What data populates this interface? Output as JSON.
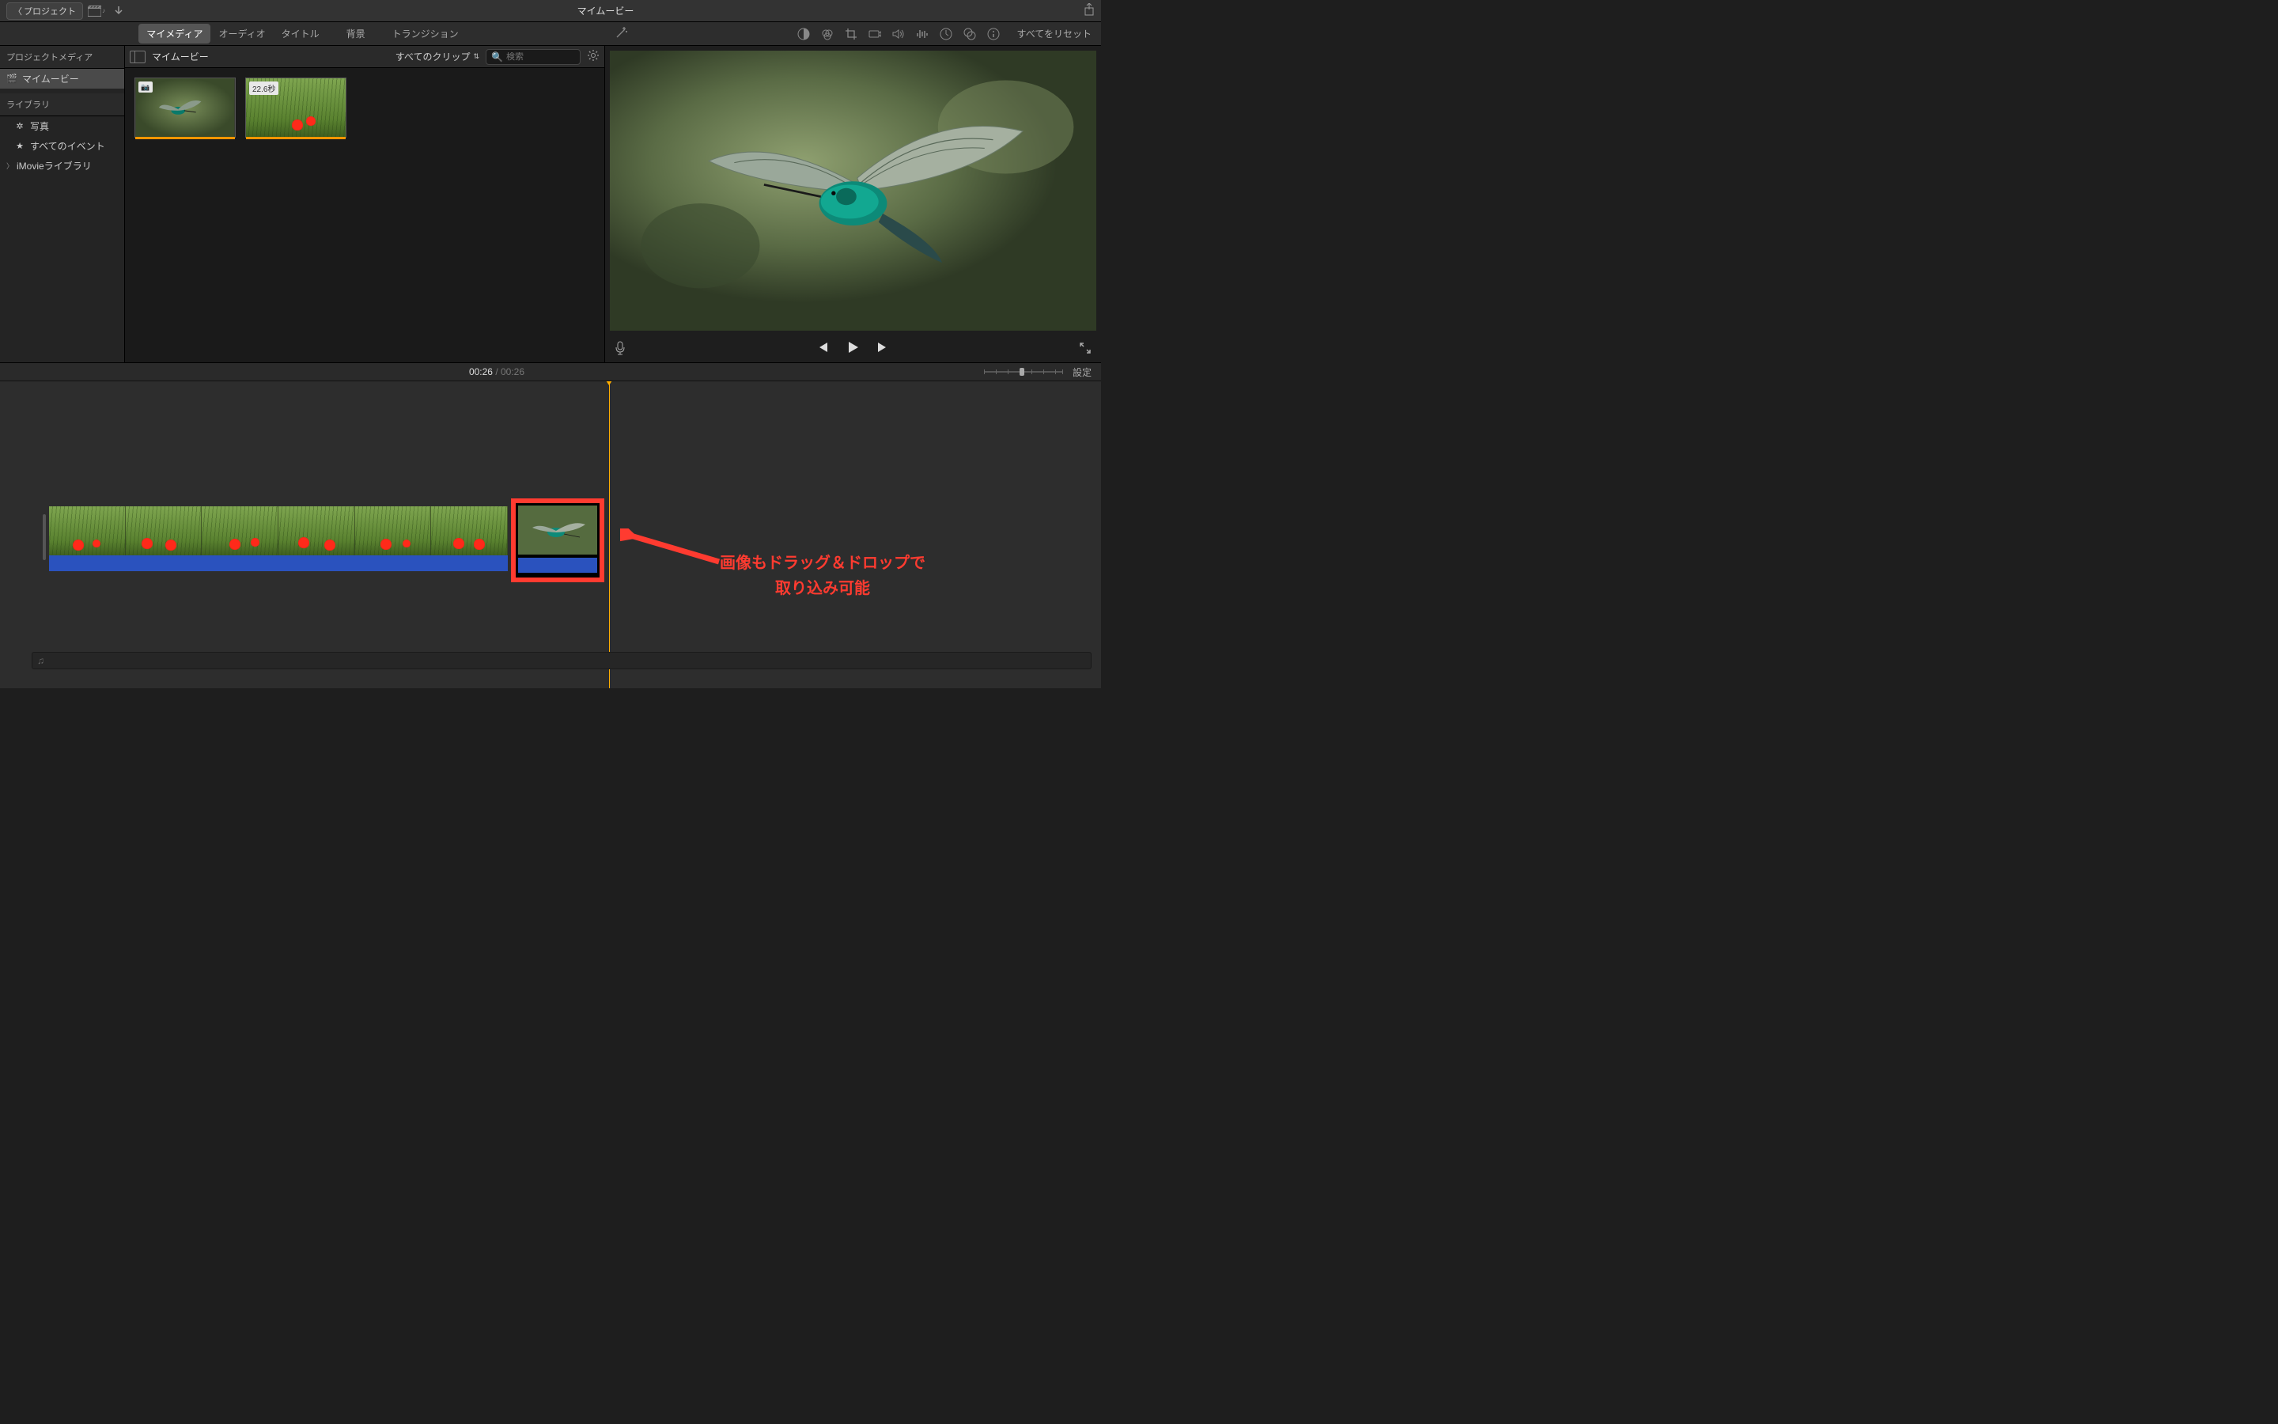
{
  "titlebar": {
    "back": "プロジェクト",
    "title": "マイムービー"
  },
  "tabs": {
    "media": "マイメディア",
    "audio": "オーディオ",
    "titles": "タイトル",
    "backgrounds": "背景",
    "transitions": "トランジション"
  },
  "adjust": {
    "reset": "すべてをリセット"
  },
  "sidebar": {
    "project_media": "プロジェクトメディア",
    "my_movie": "マイムービー",
    "library": "ライブラリ",
    "photos": "写真",
    "all_events": "すべてのイベント",
    "imovie_library": "iMovieライブラリ"
  },
  "media_bar": {
    "title": "マイムービー",
    "clip_filter": "すべてのクリップ",
    "search_placeholder": "検索"
  },
  "clips": {
    "clip2_duration": "22.6秒"
  },
  "timeline": {
    "current": "00:26",
    "duration": "00:26",
    "settings": "設定"
  },
  "annotation": {
    "line1": "画像もドラッグ＆ドロップで",
    "line2": "取り込み可能"
  }
}
